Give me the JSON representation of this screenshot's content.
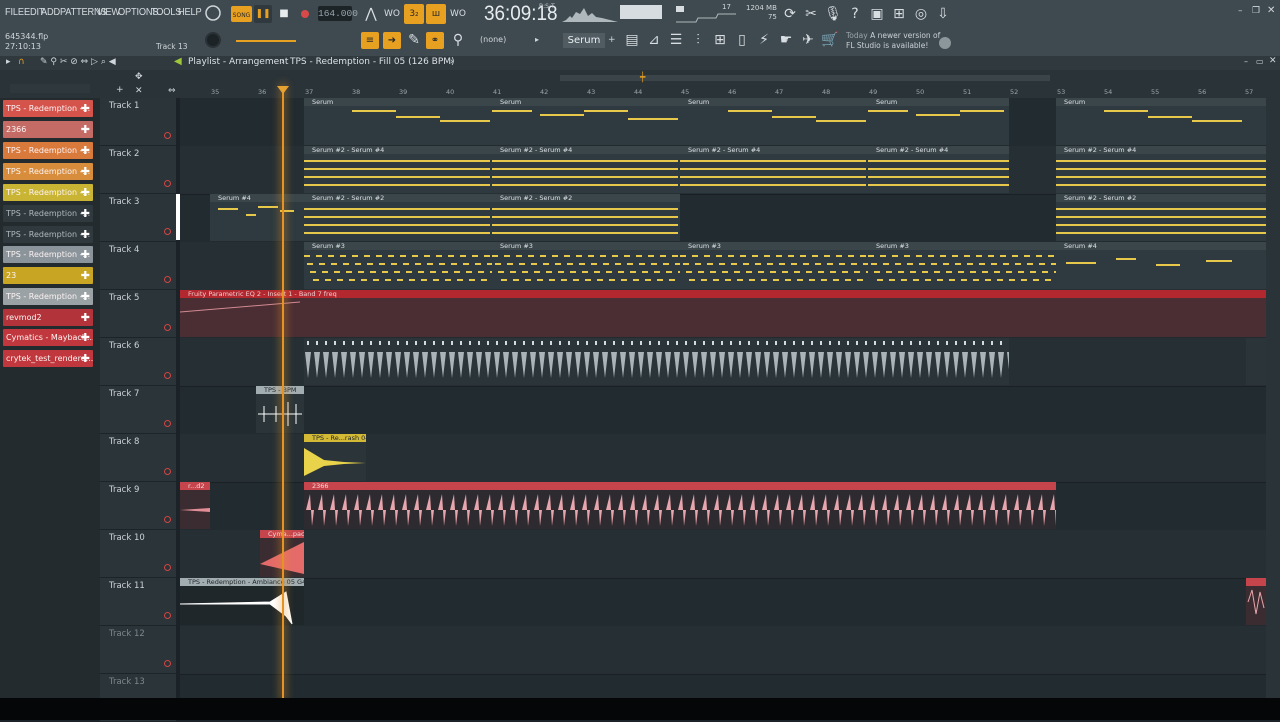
{
  "menu": [
    "FILE",
    "EDIT",
    "ADD",
    "PATTERNS",
    "VIEW",
    "OPTIONS",
    "TOOLS",
    "HELP"
  ],
  "transport": {
    "mode": "SONG",
    "tempo": "164.000",
    "song_position": "36:09:18",
    "song_position_sub": "B:S:T"
  },
  "memory": {
    "line1": "1204 MB",
    "line2": "75"
  },
  "cpu_value": "17",
  "hint": {
    "day": "Today",
    "text": "A newer version of FL Studio is available!"
  },
  "file": {
    "name": "645344.flp",
    "time": "27:10:13"
  },
  "track_hint": "Track 13",
  "pattern": {
    "selector": "(none)",
    "name": "Serum"
  },
  "playlist": {
    "title": "Playlist - Arrangement",
    "path": "TPS - Redemption - Fill 05 (126 BPM)"
  },
  "ruler": [
    "35",
    "36",
    "37",
    "38",
    "39",
    "40",
    "41",
    "42",
    "43",
    "44",
    "45",
    "46",
    "47",
    "48",
    "49",
    "50",
    "51",
    "52",
    "53",
    "54",
    "55",
    "56",
    "57"
  ],
  "picker": [
    {
      "label": "TPS - Redemption -...",
      "color": "#d4544c"
    },
    {
      "label": "2366",
      "color": "#c46b66"
    },
    {
      "label": "TPS - Redemption -...",
      "color": "#d97a3d"
    },
    {
      "label": "TPS - Redemption -...",
      "color": "#d78d3b"
    },
    {
      "label": "TPS - Redemption -...",
      "color": "#c9b533"
    },
    {
      "label": "TPS - Redemption -...",
      "color": "#2f393e"
    },
    {
      "label": "TPS - Redemption -...",
      "color": "#2f393e"
    },
    {
      "label": "TPS - Redemption -...",
      "color": "#8a949a"
    },
    {
      "label": "23",
      "color": "#c9a524"
    },
    {
      "label": "TPS - Redemption -...",
      "color": "#9aa2a6"
    },
    {
      "label": "revmod2",
      "color": "#b2343a"
    },
    {
      "label": "Cymatics - Maybach...",
      "color": "#c0383d"
    },
    {
      "label": "crytek_test_rendere...",
      "color": "#c0383d"
    }
  ],
  "tracks": [
    "Track 1",
    "Track 2",
    "Track 3",
    "Track 4",
    "Track 5",
    "Track 6",
    "Track 7",
    "Track 8",
    "Track 9",
    "Track 10",
    "Track 11",
    "Track 12",
    "Track 13"
  ],
  "clips": {
    "serum": "Serum",
    "serum2_4": "Serum #2 - Serum #4",
    "serum4": "Serum #4",
    "serum2_2": "Serum #2 - Serum #2",
    "serum3": "Serum #3",
    "automation": "Fruity Parametric EQ 2 - Insert 1 - Band 7 freq",
    "bpm": "TPS - BPM",
    "crash": "TPS - Re...rash 04",
    "rd2": "r...d2",
    "c2366": "2366",
    "cymatics": "Cyma...pact",
    "ambiance": "TPS - Redemption - Ambiance 05 G4"
  }
}
